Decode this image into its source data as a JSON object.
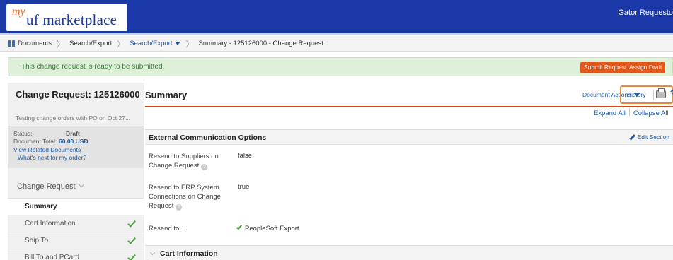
{
  "header": {
    "logo_prefix": "my",
    "logo_text": "uf marketplace",
    "user_name": "Gator Requesto"
  },
  "breadcrumb": {
    "items": [
      "Documents",
      "Search/Export",
      "Search/Export",
      "Summary - 125126000 - Change Request"
    ]
  },
  "alert": {
    "message": "This change request is ready to be submitted.",
    "submit_label": "Submit Request",
    "assign_label": "Assign Draft"
  },
  "sidebar": {
    "title": "Change Request: 125126000",
    "description": "Testing change orders with PO on Oct 27...",
    "status_label": "Status:",
    "status_value": "Draft",
    "total_label": "Document Total:",
    "total_value": "60.00 USD",
    "related_link": "View Related Documents",
    "next_link": "What's next for my order?",
    "nav_header": "Change Request",
    "nav_items": [
      {
        "label": "Summary",
        "complete": false
      },
      {
        "label": "Cart Information",
        "complete": true
      },
      {
        "label": "Ship To",
        "complete": true
      },
      {
        "label": "Bill To and PCard",
        "complete": true
      }
    ]
  },
  "main": {
    "title": "Summary",
    "doc_actions": "Document Actions",
    "history": "History",
    "help": "?",
    "expand_all": "Expand All",
    "collapse_all": "Collapse All",
    "section1": {
      "title": "External Communication Options",
      "edit": "Edit Section",
      "fields": [
        {
          "label": "Resend to Suppliers on Change Request",
          "value": "false"
        },
        {
          "label": "Resend to ERP System Connections on Change Request",
          "value": "true"
        },
        {
          "label": "Resend to...",
          "value": "PeopleSoft Export"
        }
      ]
    },
    "section2": {
      "title": "Cart Information"
    }
  },
  "colors": {
    "header_bg": "#1a38a8",
    "accent_orange": "#e4571b",
    "alert_bg": "#dff0d8",
    "link_blue": "#1f5aa6",
    "success_green": "#4aa23c"
  }
}
